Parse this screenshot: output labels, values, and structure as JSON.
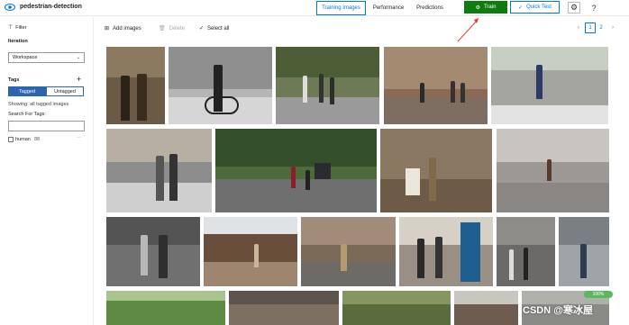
{
  "header": {
    "project_name": "pedestrian-detection",
    "tabs": [
      {
        "label": "Training Images",
        "active": true
      },
      {
        "label": "Performance",
        "active": false
      },
      {
        "label": "Predictions",
        "active": false
      }
    ],
    "train_label": "Train",
    "quick_test_label": "Quick Test",
    "settings_icon": "gear-icon",
    "help_icon": "help-icon"
  },
  "sidebar": {
    "filter_label": "Filter",
    "iteration_label": "Iteration",
    "iteration_value": "Workspace",
    "tags_label": "Tags",
    "tagged_label": "Tagged",
    "untagged_label": "Untagged",
    "showing_text": "Showing: all tagged images",
    "search_tags_label": "Search For Tags:",
    "tags": [
      {
        "name": "human",
        "count": "88"
      }
    ]
  },
  "toolbar": {
    "add_images_label": "Add images",
    "delete_label": "Delete",
    "select_all_label": "Select all"
  },
  "pagination": {
    "prev": "‹",
    "pages": [
      "1",
      "2"
    ],
    "current": "1",
    "next": "›"
  },
  "status_badge": "100%",
  "watermark": "CSDN @寒冰屋",
  "colors": {
    "accent": "#0078d4",
    "train": "#107c10",
    "tagged": "#2b65b0",
    "arrow": "#e03b3b"
  }
}
